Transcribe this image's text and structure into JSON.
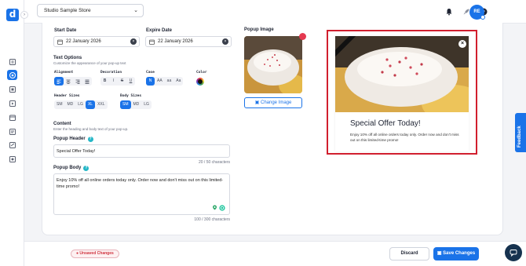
{
  "brand": {
    "logo_letter": "d",
    "accent": "#1a73e8",
    "danger": "#d11f2e"
  },
  "topbar": {
    "store_selector": "Studio Sample Store",
    "icons": [
      "bell-icon",
      "rocket-icon",
      "help-icon"
    ],
    "avatar_initials": "RE"
  },
  "sidebar": {
    "icons": [
      "box-icon",
      "target-icon",
      "grid-icon",
      "video-icon",
      "calendar-icon",
      "message-icon",
      "swap-icon",
      "toggle-icon",
      "mail-icon"
    ],
    "active_index": 1
  },
  "form": {
    "start_date": {
      "label": "Start Date",
      "value": "22 January 2026"
    },
    "expire_date": {
      "label": "Expire Date",
      "value": "22 January 2026"
    },
    "text_options": {
      "title": "Text Options",
      "subtitle": "Customize the appearance of your pop-up text"
    },
    "alignment": {
      "label": "Alignment",
      "selected": "left"
    },
    "decoration": {
      "label": "Decoration",
      "options": [
        "B",
        "I",
        "S",
        "U"
      ]
    },
    "case": {
      "label": "Case",
      "options": [
        "N",
        "AA",
        "aa",
        "Aa"
      ],
      "selected": "N"
    },
    "color": {
      "label": "Color",
      "value": "#111111"
    },
    "header_sizes": {
      "label": "Header Sizes",
      "options": [
        "SM",
        "MD",
        "LG",
        "XL",
        "XXL"
      ],
      "selected": "XL"
    },
    "body_sizes": {
      "label": "Body Sizes",
      "options": [
        "SM",
        "MD",
        "LG"
      ],
      "selected": "SM"
    },
    "content": {
      "title": "Content",
      "subtitle": "Enter the heading and body text of your pop-up."
    },
    "popup_header": {
      "label": "Popup Header",
      "value": "Special Offer Today!",
      "counter": "20 / 50 characters"
    },
    "popup_body": {
      "label": "Popup Body",
      "value": "Enjoy 10% off all online orders today only. Order now and don't miss out on this limited-time promo!",
      "counter": "100 / 300 characters"
    }
  },
  "image_panel": {
    "label": "Popup Image",
    "change_button": "Change Image"
  },
  "preview": {
    "title": "Special Offer Today!",
    "body": "Enjoy 10% off all online orders today only. Order now and don't miss out on this limited-time promo!"
  },
  "footer": {
    "unsaved_label": "Unsaved Changes",
    "discard_label": "Discard",
    "save_label": "Save Changes"
  },
  "feedback_tab": "Feedback"
}
